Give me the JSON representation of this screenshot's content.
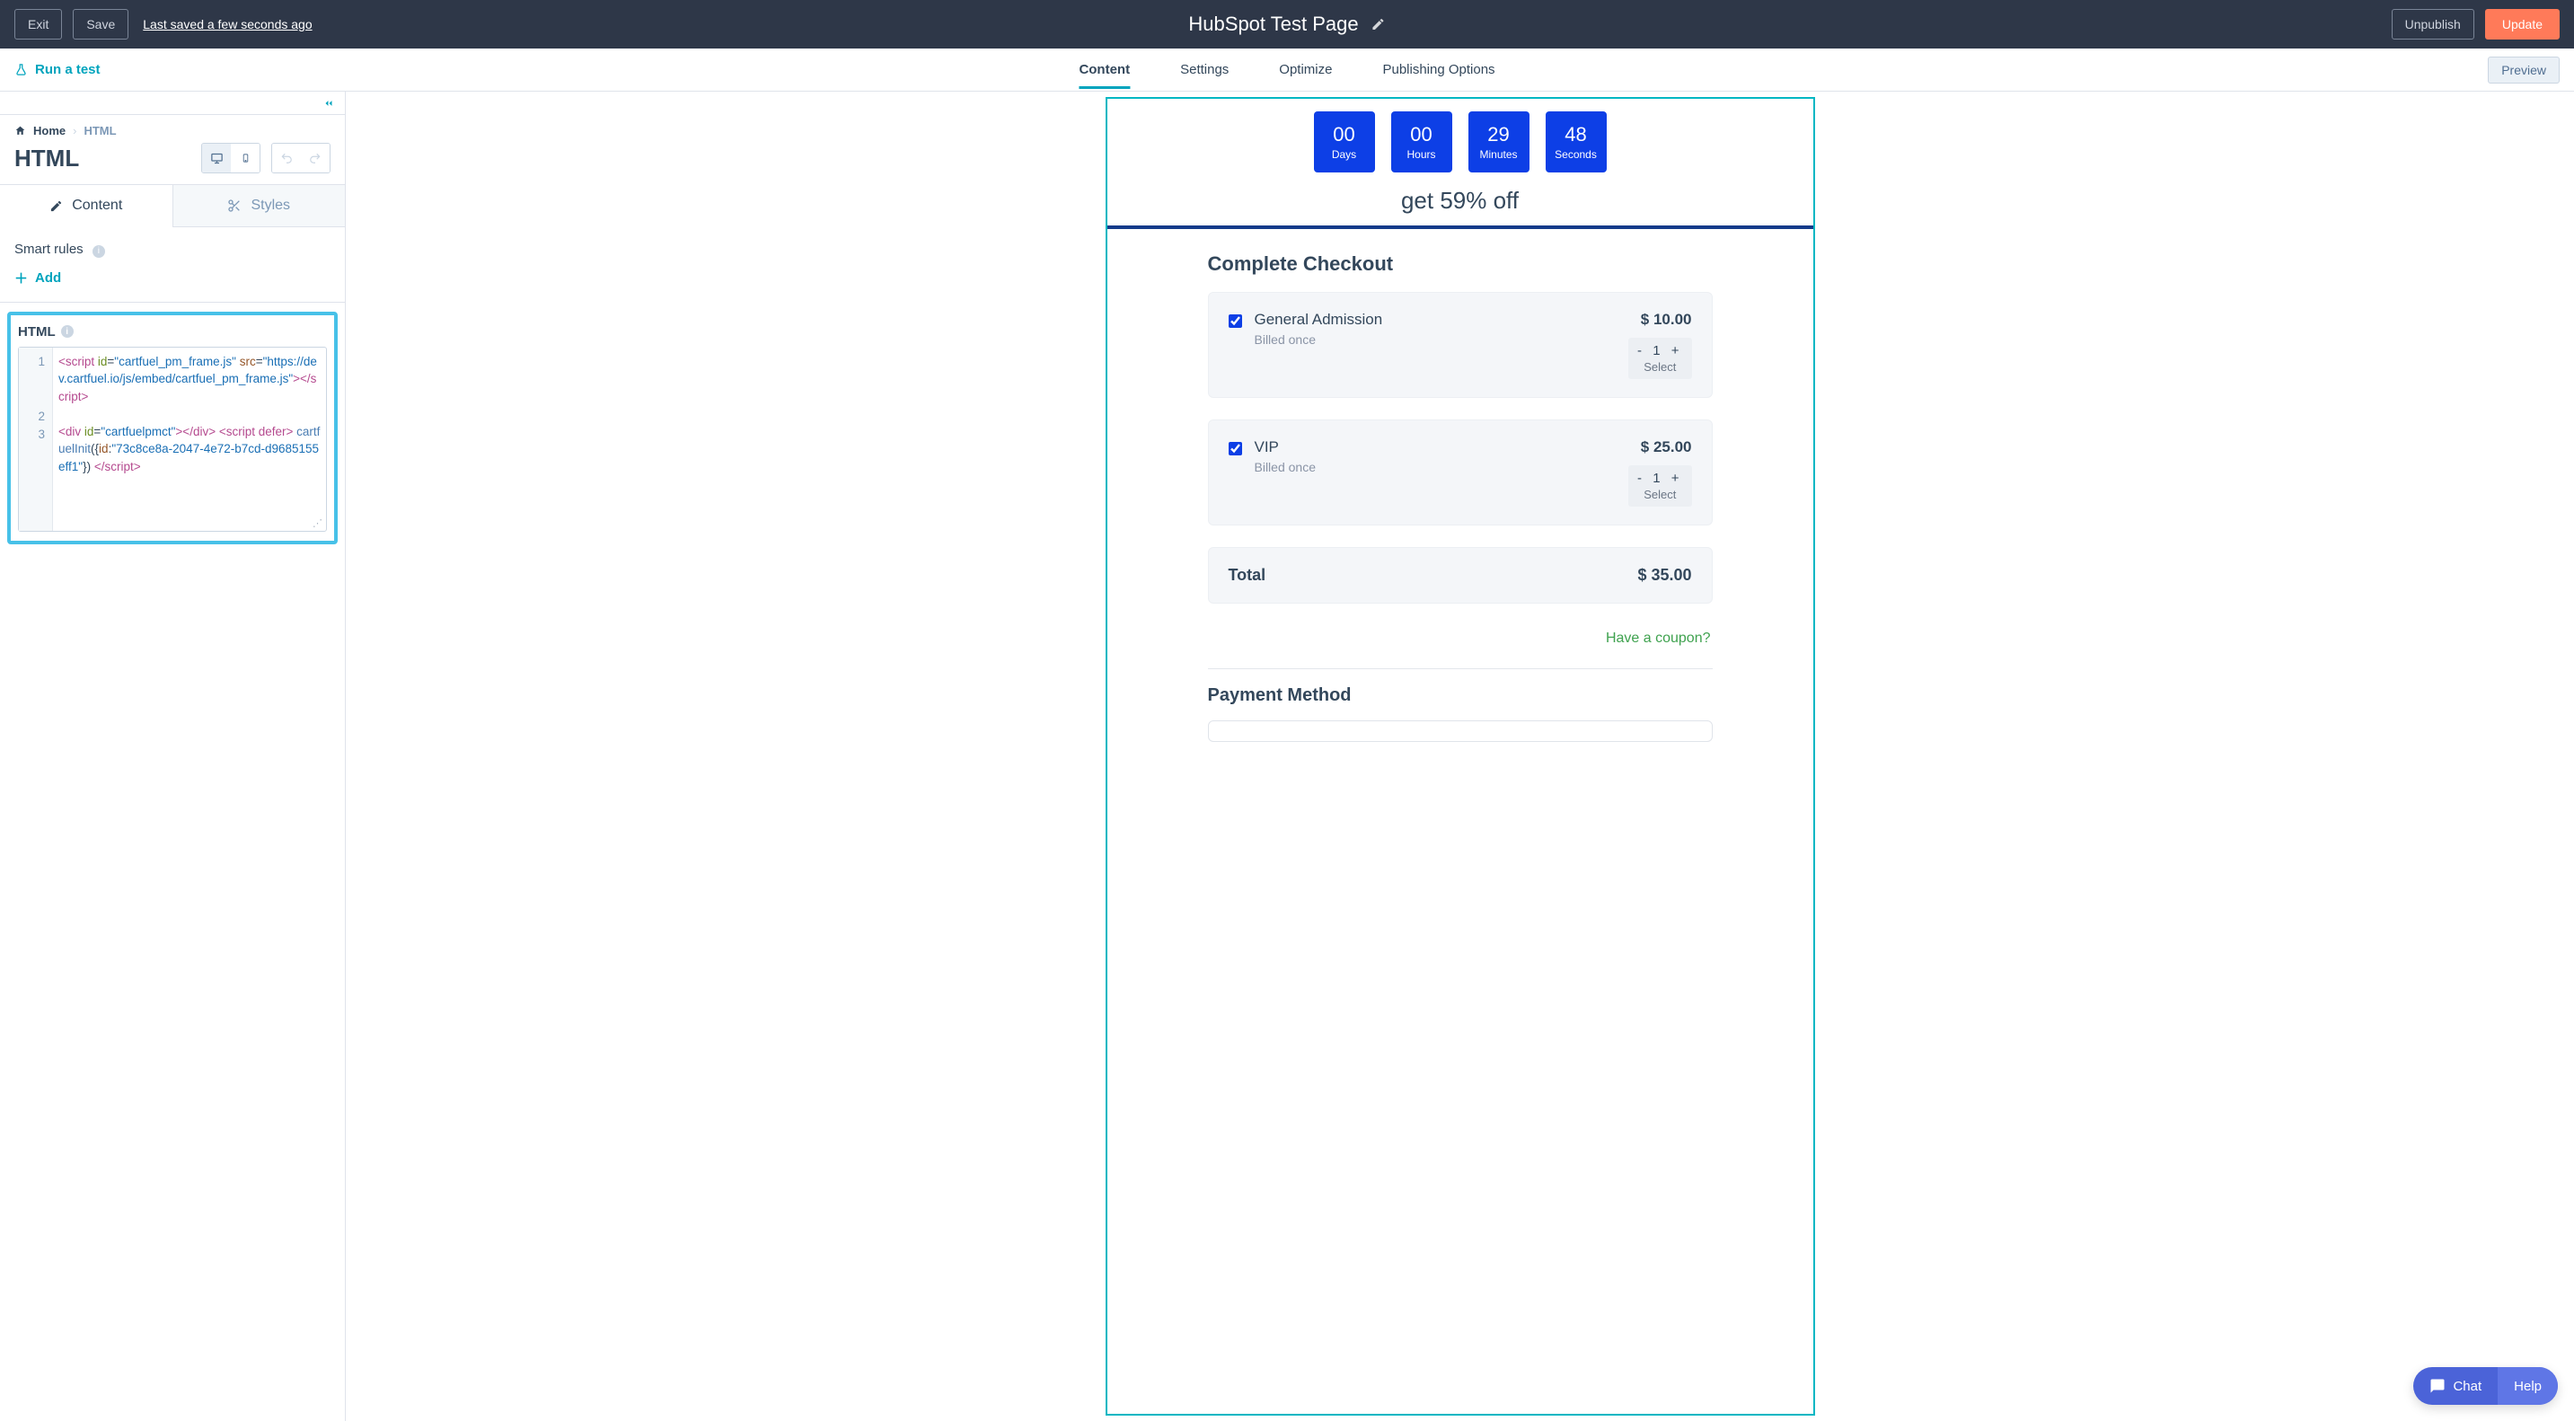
{
  "topbar": {
    "exit": "Exit",
    "save": "Save",
    "last_saved": "Last saved a few seconds ago",
    "page_title": "HubSpot Test Page",
    "unpublish": "Unpublish",
    "update": "Update"
  },
  "subheader": {
    "run_test": "Run a test",
    "tabs": [
      "Content",
      "Settings",
      "Optimize",
      "Publishing Options"
    ],
    "active_tab": "Content",
    "preview": "Preview"
  },
  "sidebar": {
    "breadcrumb_home": "Home",
    "breadcrumb_current": "HTML",
    "title": "HTML",
    "tab_content": "Content",
    "tab_styles": "Styles",
    "smart_rules_label": "Smart rules",
    "add_label": "Add",
    "html_label": "HTML",
    "code": {
      "line_numbers": [
        "1",
        "2",
        "3"
      ],
      "l1_tag_open": "<script ",
      "l1_id_attr": "id",
      "l1_id_val": "\"cartfuel_pm_frame.js\"",
      "l1_src_attr": "src",
      "l1_src_val": "\"https://dev.cartfuel.io/js/embed/cartfuel_pm_frame.js\"",
      "l1_close": "></script>",
      "l3_div_open": "<div ",
      "l3_div_id_attr": "id",
      "l3_div_id_val": "\"cartfuelpmct\"",
      "l3_div_close": "></div> ",
      "l3_script_open": "<script defer>",
      "l3_fn": " cartfuelInit",
      "l3_arg_open": "({",
      "l3_arg_key": "id",
      "l3_arg_colon": ":",
      "l3_arg_val": "\"73c8ce8a-2047-4e72-b7cd-d9685155eff1\"",
      "l3_arg_close": "}) ",
      "l3_script_close": "</script>"
    }
  },
  "canvas": {
    "countdown": [
      {
        "value": "00",
        "label": "Days"
      },
      {
        "value": "00",
        "label": "Hours"
      },
      {
        "value": "29",
        "label": "Minutes"
      },
      {
        "value": "48",
        "label": "Seconds"
      }
    ],
    "off_text": "get 59% off",
    "checkout_title": "Complete Checkout",
    "items": [
      {
        "name": "General Admission",
        "billed": "Billed once",
        "price": "$ 10.00",
        "qty": "1",
        "select": "Select"
      },
      {
        "name": "VIP",
        "billed": "Billed once",
        "price": "$ 25.00",
        "qty": "1",
        "select": "Select"
      }
    ],
    "total_label": "Total",
    "total_value": "$ 35.00",
    "coupon": "Have a coupon?",
    "payment_title": "Payment Method"
  },
  "fab": {
    "chat": "Chat",
    "help": "Help"
  }
}
